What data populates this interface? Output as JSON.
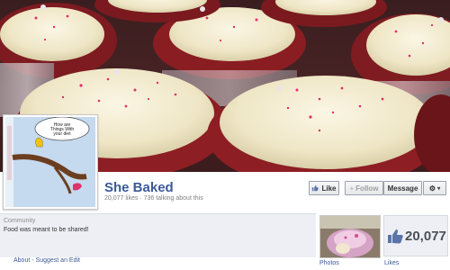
{
  "page": {
    "title": "She Baked",
    "stats": "20,077 likes · 736 talking about this",
    "category": "Community",
    "about": "Food was meant to be shared!"
  },
  "profile_picture": {
    "speech_text": "How are Things With your diet",
    "vertical_text": "Heart of a Cookie & Soul..."
  },
  "actions": {
    "like_label": "Like",
    "follow_label": "Follow",
    "message_label": "Message",
    "gear_icon": "gear-icon"
  },
  "links": {
    "about": "About",
    "separator": "-",
    "suggest_edit": "Suggest an Edit"
  },
  "apps": {
    "photos_label": "Photos",
    "likes_label": "Likes",
    "likes_count": "20,077"
  },
  "colors": {
    "brand_link": "#3b5998",
    "frosting": "#f3ecd3",
    "cake": "#8f1f24",
    "sprinkle": "#e0306a"
  }
}
